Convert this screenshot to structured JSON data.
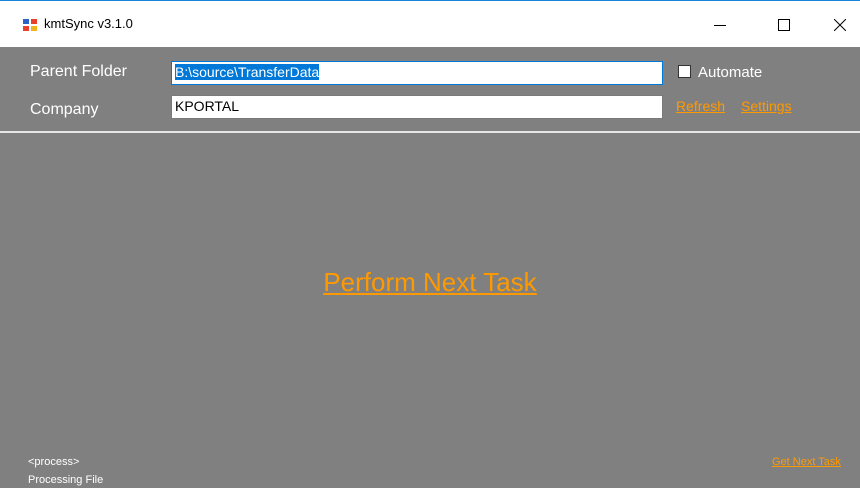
{
  "window": {
    "title": "kmtSync v3.1.0",
    "controls": {
      "minimize_icon": "minimize-icon",
      "maximize_icon": "maximize-icon",
      "close_icon": "close-icon"
    }
  },
  "form": {
    "parent_folder_label": "Parent Folder",
    "parent_folder_value": "B:\\source\\TransferData",
    "company_label": "Company",
    "company_value": "KPORTAL",
    "automate_label": "Automate",
    "automate_checked": false,
    "refresh_link": "Refresh",
    "settings_link": "Settings"
  },
  "main": {
    "perform_next_task": "Perform Next Task"
  },
  "status": {
    "process": "<process>",
    "processing_file": "Processing File",
    "get_next_task": "Get Next Task"
  },
  "colors": {
    "background": "#808080",
    "link": "#ff9900",
    "selection": "#0078d7"
  }
}
